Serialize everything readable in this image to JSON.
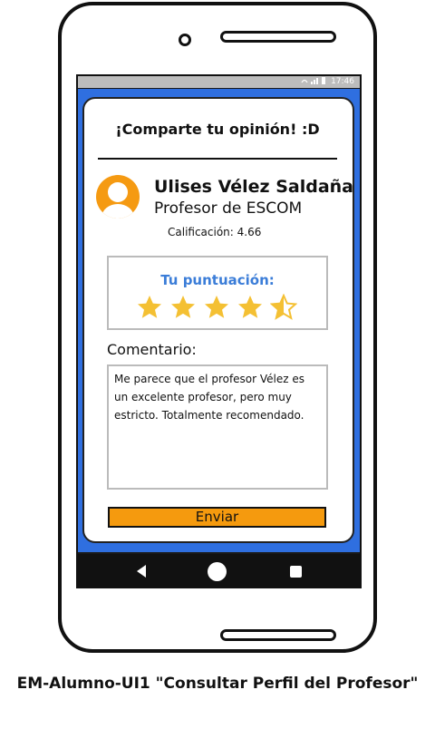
{
  "status_bar": {
    "time": "17:46",
    "icons": "wifi-icon signal-icon battery-icon"
  },
  "header": {
    "title": "¡Comparte tu opinión! :D"
  },
  "profile": {
    "name": "Ulises Vélez Saldaña",
    "subtitle": "Profesor de ESCOM",
    "rating_text": "Calificación: 4.66"
  },
  "score": {
    "label": "Tu puntuación:",
    "value": 4.5,
    "max": 5,
    "star_color": "#f4c033"
  },
  "comment": {
    "label": "Comentario:",
    "value": "Me parece que el profesor Vélez es un excelente profesor, pero muy estricto. Totalmente recomendado."
  },
  "submit": {
    "label": "Enviar",
    "color": "#f59a0e"
  },
  "colors": {
    "screen_background": "#2f6fe0",
    "accent_blue": "#3b7dd8",
    "avatar": "#f59a12"
  },
  "caption": "EM-Alumno-UI1 \"Consultar Perfil del Profesor\""
}
